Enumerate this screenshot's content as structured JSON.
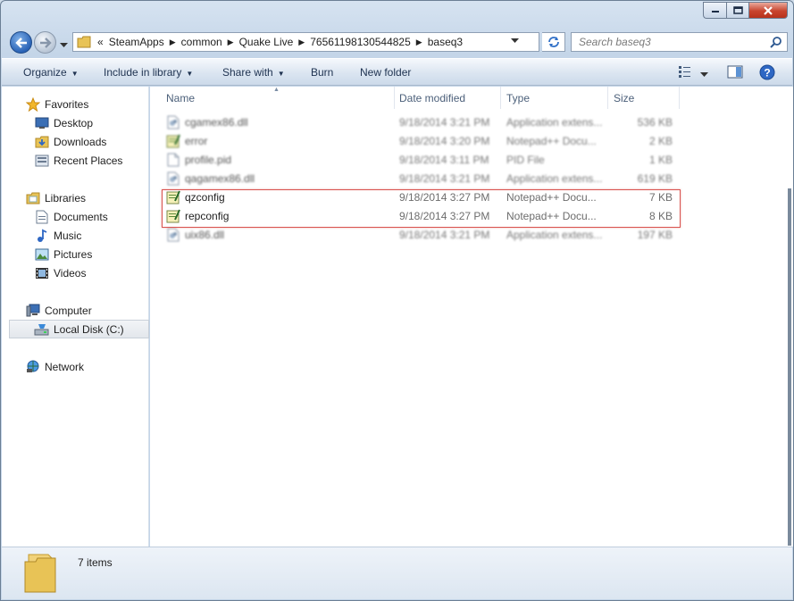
{
  "window": {
    "controls": {
      "minimize_icon": "minimize-icon",
      "maximize_icon": "maximize-icon",
      "close_icon": "close-icon"
    }
  },
  "address": {
    "overflow": "«",
    "crumbs": [
      "SteamApps",
      "common",
      "Quake Live",
      "76561198130544825",
      "baseq3"
    ],
    "search_placeholder": "Search baseq3"
  },
  "toolbar": {
    "organize": "Organize",
    "include_in_library": "Include in library",
    "share_with": "Share with",
    "burn": "Burn",
    "new_folder": "New folder"
  },
  "nav": {
    "favorites": "Favorites",
    "desktop": "Desktop",
    "downloads": "Downloads",
    "recent_places": "Recent Places",
    "libraries": "Libraries",
    "documents": "Documents",
    "music": "Music",
    "pictures": "Pictures",
    "videos": "Videos",
    "computer": "Computer",
    "local_disk": "Local Disk (C:)",
    "network": "Network"
  },
  "columns": {
    "name": "Name",
    "date_modified": "Date modified",
    "type": "Type",
    "size": "Size"
  },
  "files": [
    {
      "name": "cgamex86.dll",
      "date": "9/18/2014 3:21 PM",
      "type": "Application extens...",
      "size": "536 KB",
      "icon": "dll-icon",
      "blurred": true
    },
    {
      "name": "error",
      "date": "9/18/2014 3:20 PM",
      "type": "Notepad++ Docu...",
      "size": "2 KB",
      "icon": "notepad-icon",
      "blurred": true
    },
    {
      "name": "profile.pid",
      "date": "9/18/2014 3:11 PM",
      "type": "PID File",
      "size": "1 KB",
      "icon": "file-icon",
      "blurred": true
    },
    {
      "name": "qagamex86.dll",
      "date": "9/18/2014 3:21 PM",
      "type": "Application extens...",
      "size": "619 KB",
      "icon": "dll-icon",
      "blurred": true
    },
    {
      "name": "qzconfig",
      "date": "9/18/2014 3:27 PM",
      "type": "Notepad++ Docu...",
      "size": "7 KB",
      "icon": "notepad-icon",
      "blurred": false
    },
    {
      "name": "repconfig",
      "date": "9/18/2014 3:27 PM",
      "type": "Notepad++ Docu...",
      "size": "8 KB",
      "icon": "notepad-icon",
      "blurred": false
    },
    {
      "name": "uix86.dll",
      "date": "9/18/2014 3:21 PM",
      "type": "Application extens...",
      "size": "197 KB",
      "icon": "dll-icon",
      "blurred": true
    }
  ],
  "status": {
    "item_count": "7 items"
  },
  "colors": {
    "highlight_border": "#d9534f",
    "toolbar_text": "#1e3250",
    "selection_bg": "#e3e7ec"
  }
}
